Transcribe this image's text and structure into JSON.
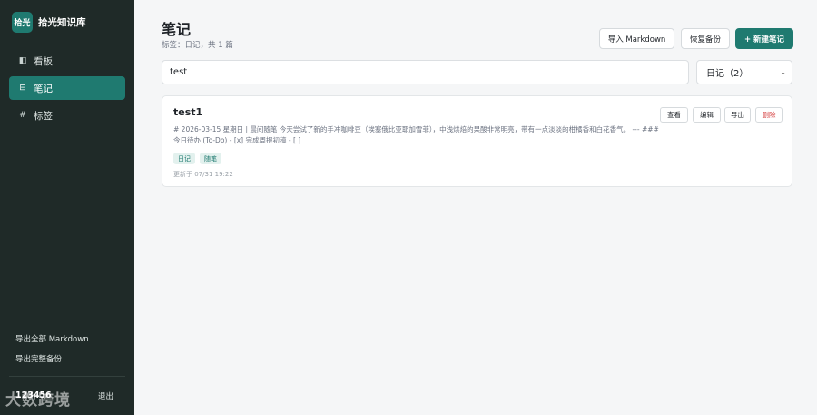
{
  "app": {
    "logo_text": "拾光",
    "name": "拾光知识库"
  },
  "sidebar": {
    "items": [
      {
        "label": "看板",
        "icon": "◧"
      },
      {
        "label": "笔记",
        "icon": "⊟"
      },
      {
        "label": "标签",
        "icon": "#"
      }
    ],
    "export_all_label": "导出全部 Markdown",
    "export_backup_label": "导出完整备份",
    "user_name": "123456",
    "logout_label": "退出"
  },
  "watermark": "大数跨境",
  "header": {
    "title": "笔记",
    "subtitle": "标签：日记，共 1 篇",
    "import_label": "导入 Markdown",
    "restore_label": "恢复备份",
    "new_label": "+ 新建笔记"
  },
  "search": {
    "value": "test",
    "placeholder": ""
  },
  "filter": {
    "selected": "日记（2）"
  },
  "notes": [
    {
      "title": "test1",
      "excerpt": "# 2026-03-15 星期日 | 晨间随笔 今天尝试了新的手冲咖啡豆（埃塞俄比亚耶加雪菲），中浅烘焙的果酸非常明亮，带有一点淡淡的柑橘香和白花香气。 --- ### 今日待办 (To-Do) - [x] 完成周报初稿 - [ ]",
      "tags": [
        "日记",
        "随笔"
      ],
      "updated": "更新于 07/31 19:22",
      "actions": {
        "view": "查看",
        "edit": "编辑",
        "export": "导出",
        "delete": "删除"
      }
    }
  ],
  "colors": {
    "accent": "#1f7a70",
    "sidebar_bg": "#1f2a28",
    "danger": "#d43c3c"
  }
}
